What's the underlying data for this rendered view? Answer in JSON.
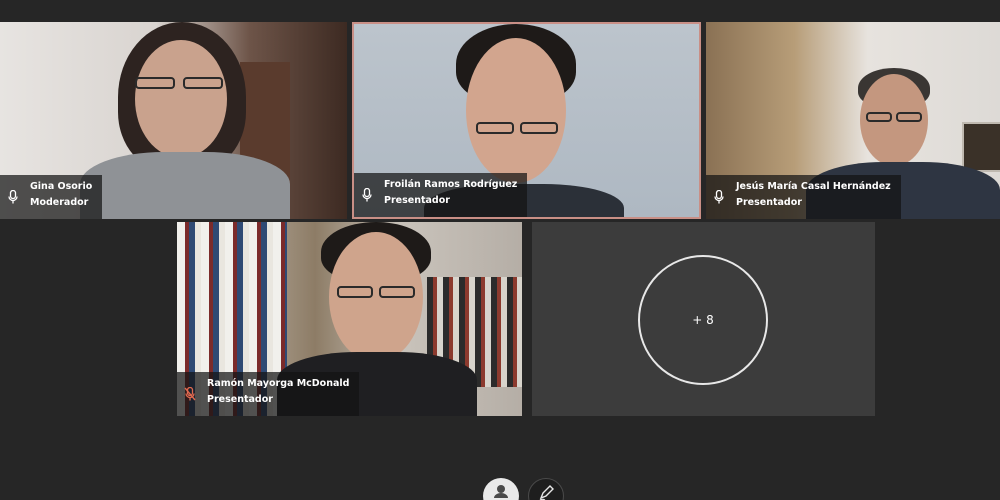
{
  "participants": [
    {
      "name": "Gina Osorio",
      "role": "Moderador"
    },
    {
      "name": "Froilán Ramos Rodríguez",
      "role": "Presentador"
    },
    {
      "name": "Jesús María Casal Hernández",
      "role": "Presentador"
    },
    {
      "name": "Ramón Mayorga McDonald",
      "role": "Presentador"
    }
  ],
  "overflow": {
    "label": "+ 8"
  },
  "icons": {
    "mic": "microphone-icon",
    "mic_muted": "microphone-muted-icon",
    "user": "user-icon",
    "pen": "pen-icon"
  },
  "colors": {
    "active_border": "#c98f86",
    "muted_icon": "#e0694f"
  }
}
